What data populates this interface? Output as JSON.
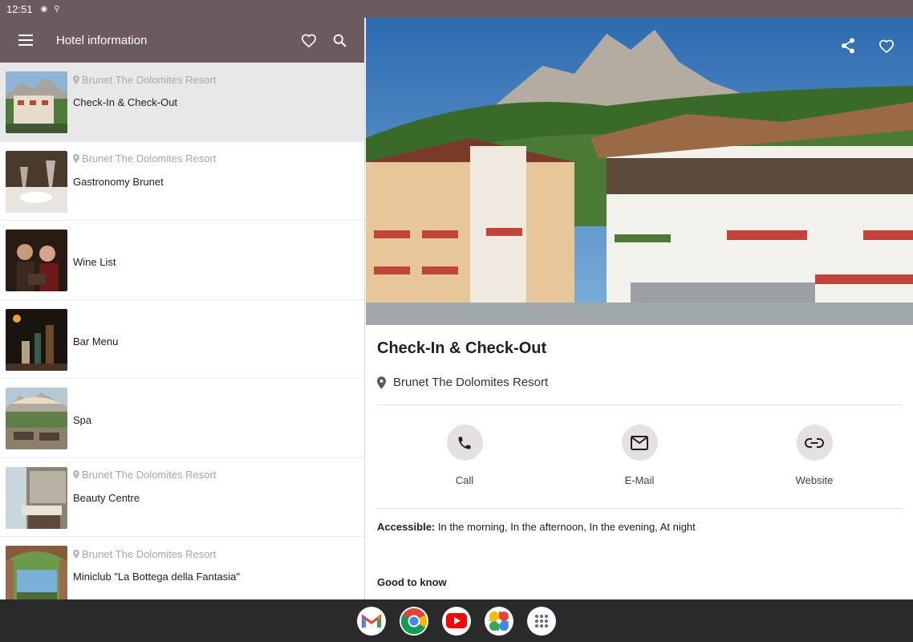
{
  "status_bar": {
    "time": "12:51"
  },
  "app_bar": {
    "title": "Hotel information"
  },
  "list": [
    {
      "location": "Brunet The Dolomites Resort",
      "name": "Check-In & Check-Out",
      "selected": true
    },
    {
      "location": "Brunet The Dolomites Resort",
      "name": "Gastronomy Brunet"
    },
    {
      "location": "",
      "name": "Wine List"
    },
    {
      "location": "",
      "name": "Bar Menu"
    },
    {
      "location": "",
      "name": "Spa"
    },
    {
      "location": "Brunet The Dolomites Resort",
      "name": "Beauty Centre"
    },
    {
      "location": "Brunet The Dolomites Resort",
      "name": "Miniclub \"La Bottega della Fantasia\""
    }
  ],
  "detail": {
    "title": "Check-In & Check-Out",
    "location": "Brunet The Dolomites Resort",
    "actions": {
      "call": "Call",
      "email": "E-Mail",
      "website": "Website"
    },
    "accessible_label": "Accessible:",
    "accessible_value": "In the morning, In the afternoon, In the evening, At night",
    "good_to_know": "Good to know"
  },
  "colors": {
    "primary": "#6b5b5e",
    "action_bg": "#e6e1e1",
    "selected_row": "#e8e8e8",
    "navbar": "#2a2a2a"
  },
  "icons": [
    "menu-icon",
    "heart-icon",
    "search-icon",
    "share-icon",
    "location-pin-icon",
    "phone-icon",
    "mail-icon",
    "link-icon",
    "gmail-icon",
    "chrome-icon",
    "youtube-icon",
    "photos-icon",
    "app-drawer-icon"
  ]
}
